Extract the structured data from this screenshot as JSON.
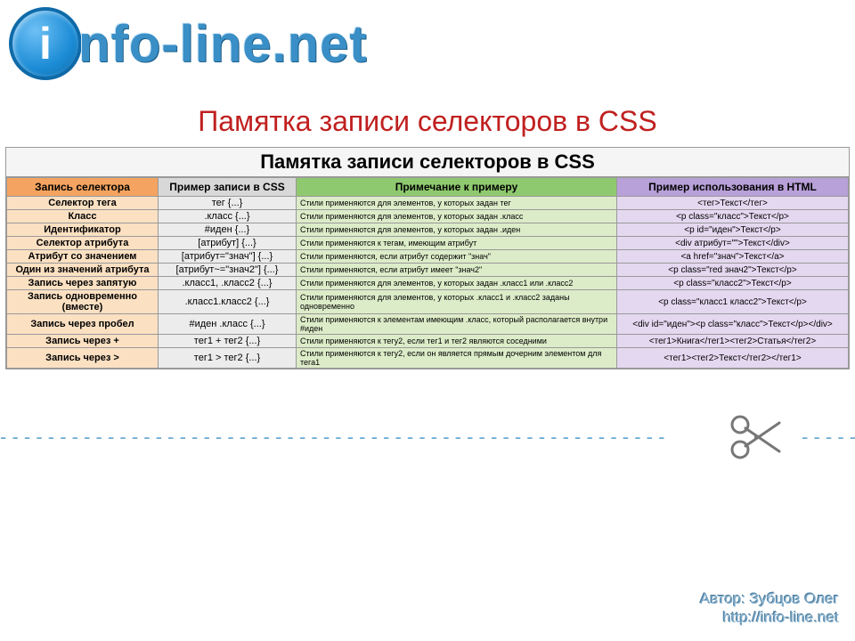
{
  "logo": {
    "icon_letter": "i",
    "text": "nfo-line",
    "suffix": ".net"
  },
  "page_title": "Памятка записи селекторов в CSS",
  "table": {
    "caption": "Памятка записи селекторов в CSS",
    "headers": {
      "c1": "Запись селектора",
      "c2": "Пример записи в CSS",
      "c3": "Примечание к примеру",
      "c4": "Пример использования в HTML"
    },
    "rows": [
      {
        "c1": "Селектор тега",
        "c2": "тег {...}",
        "c3": "Стили применяются для элементов, у которых задан тег",
        "c4": "<тег>Текст</тег>"
      },
      {
        "c1": "Класс",
        "c2": ".класс {...}",
        "c3": "Стили применяются для элементов, у которых задан .класс",
        "c4": "<p class=\"класс\">Текст</p>"
      },
      {
        "c1": "Идентификатор",
        "c2": "#иден {...}",
        "c3": "Стили применяются для элементов, у которых задан .иден",
        "c4": "<p id=\"иден\">Текст</p>"
      },
      {
        "c1": "Селектор атрибута",
        "c2": "[атрибут] {...}",
        "c3": "Стили применяются к тегам, имеющим атрибут",
        "c4": "<div атрибут=\"\">Текст</div>"
      },
      {
        "c1": "Атрибут со значением",
        "c2": "[атрибут=\"знач\"] {...}",
        "c3": "Стили применяются, если атрибут содержит \"знач\"",
        "c4": "<a href=\"знач\">Текст</a>"
      },
      {
        "c1": "Один из значений атрибута",
        "c2": "[атрибут~=\"знач2\"] {...}",
        "c3": "Стили применяются, если атрибут имеет \"знач2\"",
        "c4": "<p class=\"red знач2\">Текст</p>"
      },
      {
        "c1": "Запись через запятую",
        "c2": ".класс1, .класс2 {...}",
        "c3": "Стили применяются для элементов, у которых задан .класс1 или .класс2",
        "c4": "<p class=\"класс2\">Текст</p>"
      },
      {
        "c1": "Запись одновременно (вместе)",
        "c2": ".класс1.класс2 {...}",
        "c3": "Стили применяются для элементов, у которых .класс1 и .класс2 заданы одновременно",
        "c4": "<p class=\"класс1 класс2\">Текст</p>"
      },
      {
        "c1": "Запись через пробел",
        "c2": "#иден .класс {...}",
        "c3": "Стили применяются к элементам имеющим .класс, который располагается внутри #иден",
        "c4": "<div id=\"иден\"><p class=\"класс\">Текст</p></div>"
      },
      {
        "c1": "Запись через +",
        "c2": "тег1 + тег2 {...}",
        "c3": "Стили применяются к тегу2, если тег1 и тег2 являются соседними",
        "c4": "<тег1>Книга</тег1><тег2>Статья</тег2>"
      },
      {
        "c1": "Запись через >",
        "c2": "тег1 > тег2 {...}",
        "c3": "Стили применяются к тегу2, если он является прямым дочерним элементом для тега1",
        "c4": "<тег1><тег2>Текст</тег2></тег1>"
      }
    ]
  },
  "credit": {
    "line1": "Автор: Зубцов Олег",
    "line2": "http://info-line.net"
  }
}
